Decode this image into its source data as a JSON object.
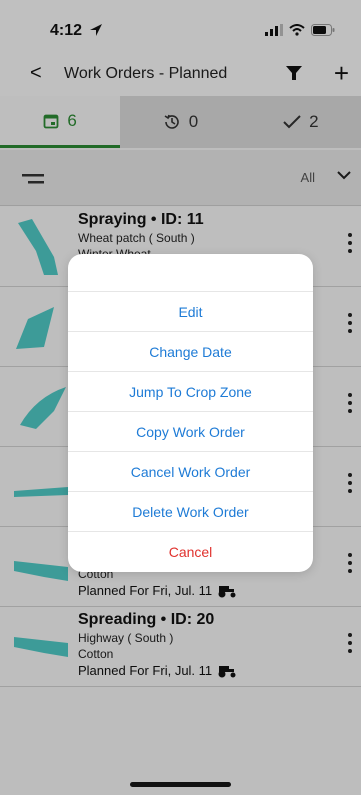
{
  "status_bar": {
    "time": "4:12"
  },
  "nav": {
    "back_glyph": "<",
    "title": "Work Orders - Planned",
    "add_glyph": "+"
  },
  "tabs": [
    {
      "name": "planned",
      "icon": "calendar-icon",
      "count": "6"
    },
    {
      "name": "history",
      "icon": "history-icon",
      "count": "0"
    },
    {
      "name": "completed",
      "icon": "check-icon",
      "count": "2"
    }
  ],
  "toolbar": {
    "filter_value": "All"
  },
  "list": [
    {
      "title": "Spraying • ID: 11",
      "line1": "Wheat patch ( South )",
      "line2": "Winter Wheat",
      "planned": ""
    },
    {
      "title": "",
      "line1": "",
      "line2": "",
      "planned": ""
    },
    {
      "title": "",
      "line1": "",
      "line2": "",
      "planned": ""
    },
    {
      "title": "",
      "line1": "",
      "line2": "",
      "planned": ""
    },
    {
      "title": "",
      "line1": "",
      "line2": "Cotton",
      "planned": "Planned For Fri, Jul. 11"
    },
    {
      "title": "Spreading • ID: 20",
      "line1": "Highway ( South )",
      "line2": "Cotton",
      "planned": "Planned For Fri, Jul. 11"
    }
  ],
  "action_sheet": {
    "items": [
      "Edit",
      "Change Date",
      "Jump To Crop Zone",
      "Copy Work Order",
      "Cancel Work Order",
      "Delete Work Order"
    ],
    "cancel": "Cancel"
  },
  "colors": {
    "accent": "#2c8a34",
    "link": "#1e7bd6",
    "destructive": "#e0322e",
    "thumb": "#4fc7c3"
  }
}
